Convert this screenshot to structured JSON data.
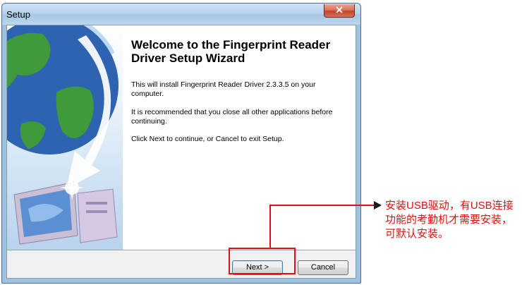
{
  "window": {
    "title": "Setup",
    "close_glyph": "✕",
    "heading": "Welcome to the Fingerprint Reader Driver Setup Wizard",
    "paragraphs": [
      "This will install Fingerprint Reader Driver 2.3.3.5 on your computer.",
      "It is recommended that you close all other applications before continuing.",
      "Click Next to continue, or Cancel to exit Setup."
    ],
    "next_label": "Next >",
    "cancel_label": "Cancel"
  },
  "annotation": {
    "text": "安装USB驱动，有USB连接功能的考勤机才需要安装，可默认安装。",
    "color": "#e01010"
  },
  "colors": {
    "title_bar": "#b7d3ec",
    "close_button": "#c4432a",
    "banner_globe": "#2a5fae"
  },
  "icons": [
    "close-icon",
    "globe-computer-illustration",
    "arrow-icon"
  ]
}
